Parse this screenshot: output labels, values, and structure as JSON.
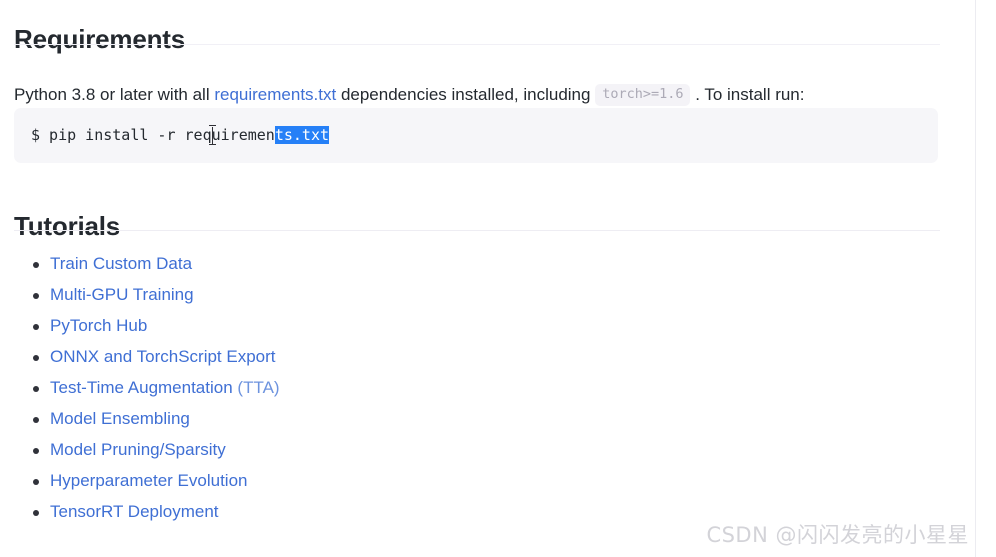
{
  "sections": {
    "requirements": {
      "heading": "Requirements",
      "intro": {
        "before_link": "Python 3.8 or later with all ",
        "link_label": "requirements.txt",
        "after_link": " dependencies installed, including ",
        "code_span": "torch>=1.6",
        "tail": " . To install run:"
      },
      "code_block": {
        "prompt_and_command": "$ pip install -r requiremen",
        "selected_text": "ts.txt",
        "full_command": "$ pip install -r requirements.txt",
        "selection_color": "#2680f7",
        "selection_text_color": "#ffffff",
        "background": "#f6f6f9"
      }
    },
    "tutorials": {
      "heading": "Tutorials",
      "items": [
        {
          "label": "Train Custom Data",
          "muted_suffix": ""
        },
        {
          "label": "Multi-GPU Training",
          "muted_suffix": ""
        },
        {
          "label": "PyTorch Hub",
          "muted_suffix": ""
        },
        {
          "label": "ONNX and TorchScript Export",
          "muted_suffix": ""
        },
        {
          "label": "Test-Time Augmentation ",
          "muted_suffix": "(TTA)"
        },
        {
          "label": "Model Ensembling",
          "muted_suffix": ""
        },
        {
          "label": "Model Pruning/Sparsity",
          "muted_suffix": ""
        },
        {
          "label": "Hyperparameter Evolution",
          "muted_suffix": ""
        },
        {
          "label": "TensorRT Deployment",
          "muted_suffix": ""
        }
      ]
    }
  },
  "watermark": "CSDN @闪闪发亮的小星星",
  "colors": {
    "link": "#3f6fd4",
    "text": "#24292f",
    "rule": "#f1f0f6",
    "code_bg": "#f6f6f9",
    "watermark": "#d3d3d8"
  }
}
